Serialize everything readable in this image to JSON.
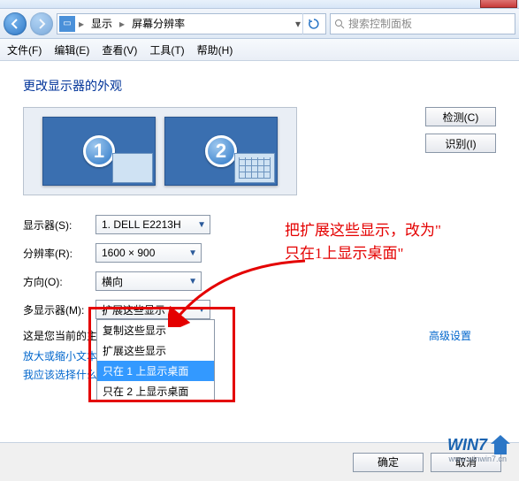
{
  "titlebar": {
    "close_visible": true
  },
  "nav": {
    "root": "显示",
    "current": "屏幕分辨率",
    "search_placeholder": "搜索控制面板"
  },
  "menubar": {
    "file": "文件(F)",
    "edit": "编辑(E)",
    "view": "查看(V)",
    "tools": "工具(T)",
    "help": "帮助(H)"
  },
  "page": {
    "title": "更改显示器的外观",
    "detect": "检测(C)",
    "identify": "识别(I)",
    "monitors": [
      "1",
      "2"
    ],
    "labels": {
      "display": "显示器(S):",
      "resolution": "分辨率(R):",
      "orientation": "方向(O):",
      "multi": "多显示器(M):"
    },
    "display_value": "1. DELL E2213H",
    "resolution_value": "1600 × 900",
    "orientation_value": "横向",
    "multi_value": "扩展这些显示",
    "multi_options": [
      "复制这些显示",
      "扩展这些显示",
      "只在 1 上显示桌面",
      "只在 2 上显示桌面"
    ],
    "multi_selected_index": 2,
    "main_text_prefix": "这是您当前的主",
    "advanced": "高级设置",
    "zoom_link_prefix": "放大或缩小文本",
    "which_link": "我应该选择什么显示器设置？",
    "ok": "确定",
    "cancel": "取消"
  },
  "annotation": {
    "line1": "把扩展这些显示，改为\"",
    "line2": "只在1上显示桌面\""
  },
  "watermark": {
    "text": "WIN7",
    "sub": "www.winwin7.cn"
  }
}
